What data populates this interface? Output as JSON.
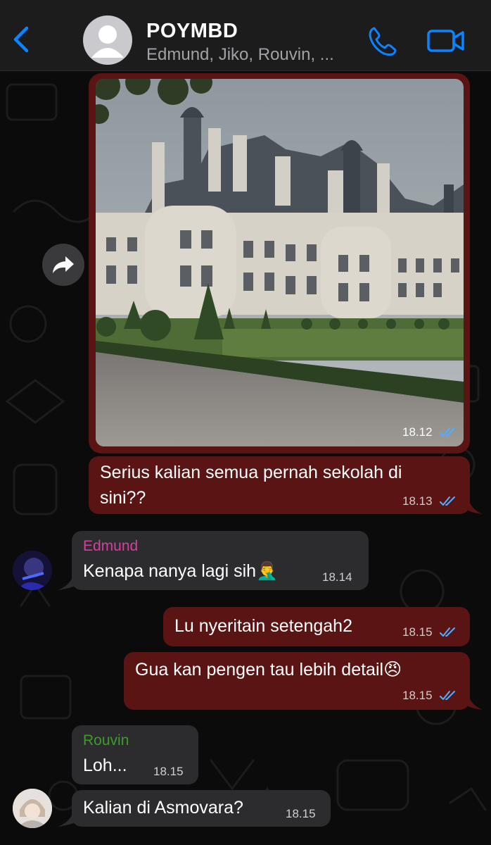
{
  "header": {
    "title": "POYMBD",
    "subtitle": "Edmund, Jiko, Rouvin, ...",
    "accent": "#0a84ff"
  },
  "colors": {
    "outgoing_bubble": "#5a1414",
    "incoming_bubble": "#2c2c2e",
    "read_ticks": "#4fb0ff",
    "edmund_name": "#d63fa0",
    "rouvin_name": "#3e9b2a"
  },
  "messages": [
    {
      "type": "image",
      "direction": "out",
      "time": "18.12",
      "image_desc": "castle-photo"
    },
    {
      "direction": "out",
      "line1": "Serius kalian semua pernah sekolah di",
      "line2": "sini??",
      "time": "18.13"
    },
    {
      "direction": "in",
      "sender": "Edmund",
      "text": "Kenapa nanya lagi sih",
      "emoji": "🤦‍♂️",
      "time": "18.14"
    },
    {
      "direction": "out",
      "text": "Lu nyeritain setengah2",
      "time": "18.15"
    },
    {
      "direction": "out",
      "text": "Gua kan pengen tau lebih detail",
      "emoji": "😠",
      "time": "18.15"
    },
    {
      "direction": "in",
      "sender": "Rouvin",
      "text": "Loh...",
      "time": "18.15"
    },
    {
      "direction": "in",
      "text": "Kalian di Asmovara?",
      "time": "18.15"
    }
  ]
}
